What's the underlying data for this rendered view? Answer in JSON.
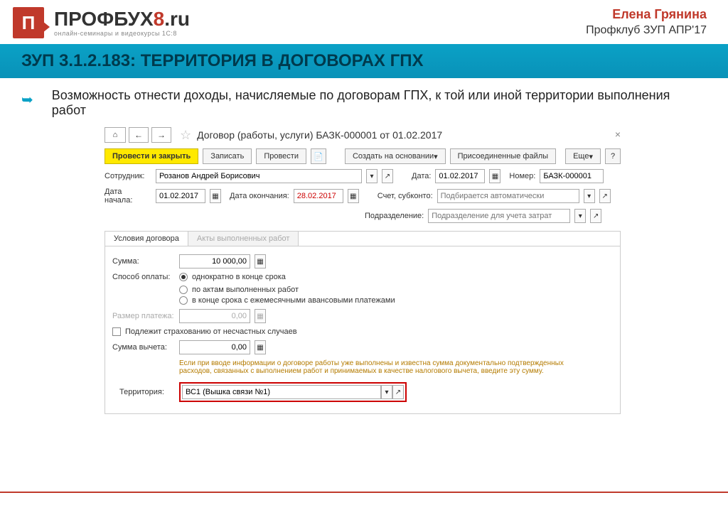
{
  "header": {
    "logo_main_1": "ПРОФБУХ",
    "logo_main_2": "8",
    "logo_main_3": ".ru",
    "logo_sub": "онлайн-семинары и видеокурсы 1С:8",
    "author_name": "Елена Грянина",
    "author_sub": "Профклуб ЗУП АПР'17"
  },
  "title": "ЗУП 3.1.2.183: ТЕРРИТОРИЯ В ДОГОВОРАХ ГПХ",
  "bullet": "Возможность отнести доходы, начисляемые по договорам ГПХ, к той или иной территории выполнения работ",
  "window": {
    "title": "Договор (работы, услуги) БАЗК-000001 от 01.02.2017",
    "toolbar": {
      "post_close": "Провести и закрыть",
      "save": "Записать",
      "post": "Провести",
      "create_based": "Создать на основании",
      "attached": "Присоединенные файлы",
      "more": "Еще"
    },
    "row1": {
      "employee_lbl": "Сотрудник:",
      "employee_val": "Розанов Андрей Борисович",
      "date_lbl": "Дата:",
      "date_val": "01.02.2017",
      "number_lbl": "Номер:",
      "number_val": "БАЗК-000001"
    },
    "row2": {
      "start_lbl": "Дата начала:",
      "start_val": "01.02.2017",
      "end_lbl": "Дата окончания:",
      "end_val": "28.02.2017",
      "account_lbl": "Счет, субконто:",
      "account_ph": "Подбирается автоматически"
    },
    "row3": {
      "subdiv_lbl": "Подразделение:",
      "subdiv_ph": "Подразделение для учета затрат"
    },
    "tabs": {
      "tab1": "Условия договора",
      "tab2": "Акты выполненных работ"
    },
    "contract": {
      "sum_lbl": "Сумма:",
      "sum_val": "10 000,00",
      "payment_lbl": "Способ оплаты:",
      "opt1": "однократно в конце срока",
      "opt2": "по актам выполненных работ",
      "opt3": "в конце срока с ежемесячными авансовыми платежами",
      "installment_lbl": "Размер платежа:",
      "installment_val": "0,00",
      "insurance_lbl": "Подлежит страхованию от несчастных случаев",
      "deduction_lbl": "Сумма вычета:",
      "deduction_val": "0,00",
      "hint": "Если при вводе информации о договоре работы уже выполнены и известна сумма документально подтвержденных расходов, связанных с выполнением работ и принимаемых в качестве налогового вычета, введите эту сумму.",
      "territory_lbl": "Территория:",
      "territory_val": "ВС1 (Вышка связи №1)"
    }
  }
}
